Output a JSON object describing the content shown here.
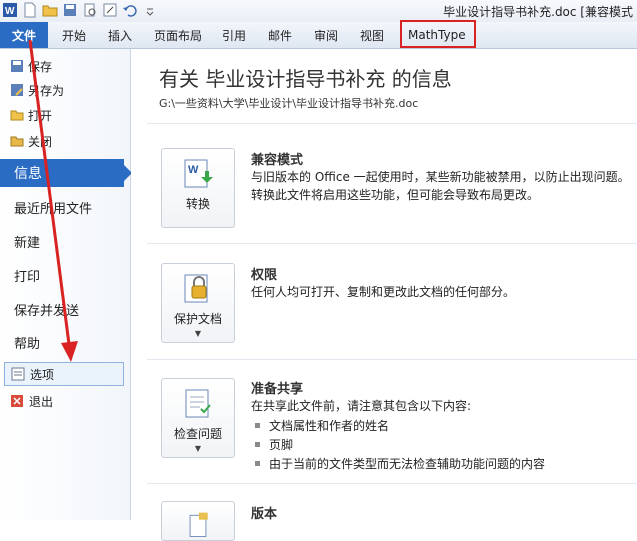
{
  "window": {
    "title": "毕业设计指导书补充.doc [兼容模式"
  },
  "ribbon": {
    "file_tab": "文件",
    "tabs": [
      "开始",
      "插入",
      "页面布局",
      "引用",
      "邮件",
      "审阅",
      "视图",
      "MathType"
    ]
  },
  "sidebar": {
    "top_items": [
      "保存",
      "另存为",
      "打开",
      "关闭"
    ],
    "active": "信息",
    "big_items": [
      "最近所用文件",
      "新建",
      "打印",
      "保存并发送",
      "帮助"
    ],
    "options": "选项",
    "exit": "退出"
  },
  "info": {
    "heading": "有关 毕业设计指导书补充 的信息",
    "path": "G:\\一些资料\\大学\\毕业设计\\毕业设计指导书补充.doc",
    "sections": [
      {
        "button": "转换",
        "title": "兼容模式",
        "desc": "与旧版本的 Office 一起使用时，某些新功能被禁用，以防止出现问题。转换此文件将启用这些功能，但可能会导致布局更改。"
      },
      {
        "button": "保护文档",
        "title": "权限",
        "desc": "任何人均可打开、复制和更改此文档的任何部分。"
      },
      {
        "button": "检查问题",
        "title": "准备共享",
        "desc": "在共享此文件前，请注意其包含以下内容:",
        "bullets": [
          "文档属性和作者的姓名",
          "页脚",
          "由于当前的文件类型而无法检查辅助功能问题的内容"
        ]
      },
      {
        "title": "版本"
      }
    ]
  },
  "colors": {
    "accent": "#2a6bc4",
    "annotation": "#d92222"
  }
}
